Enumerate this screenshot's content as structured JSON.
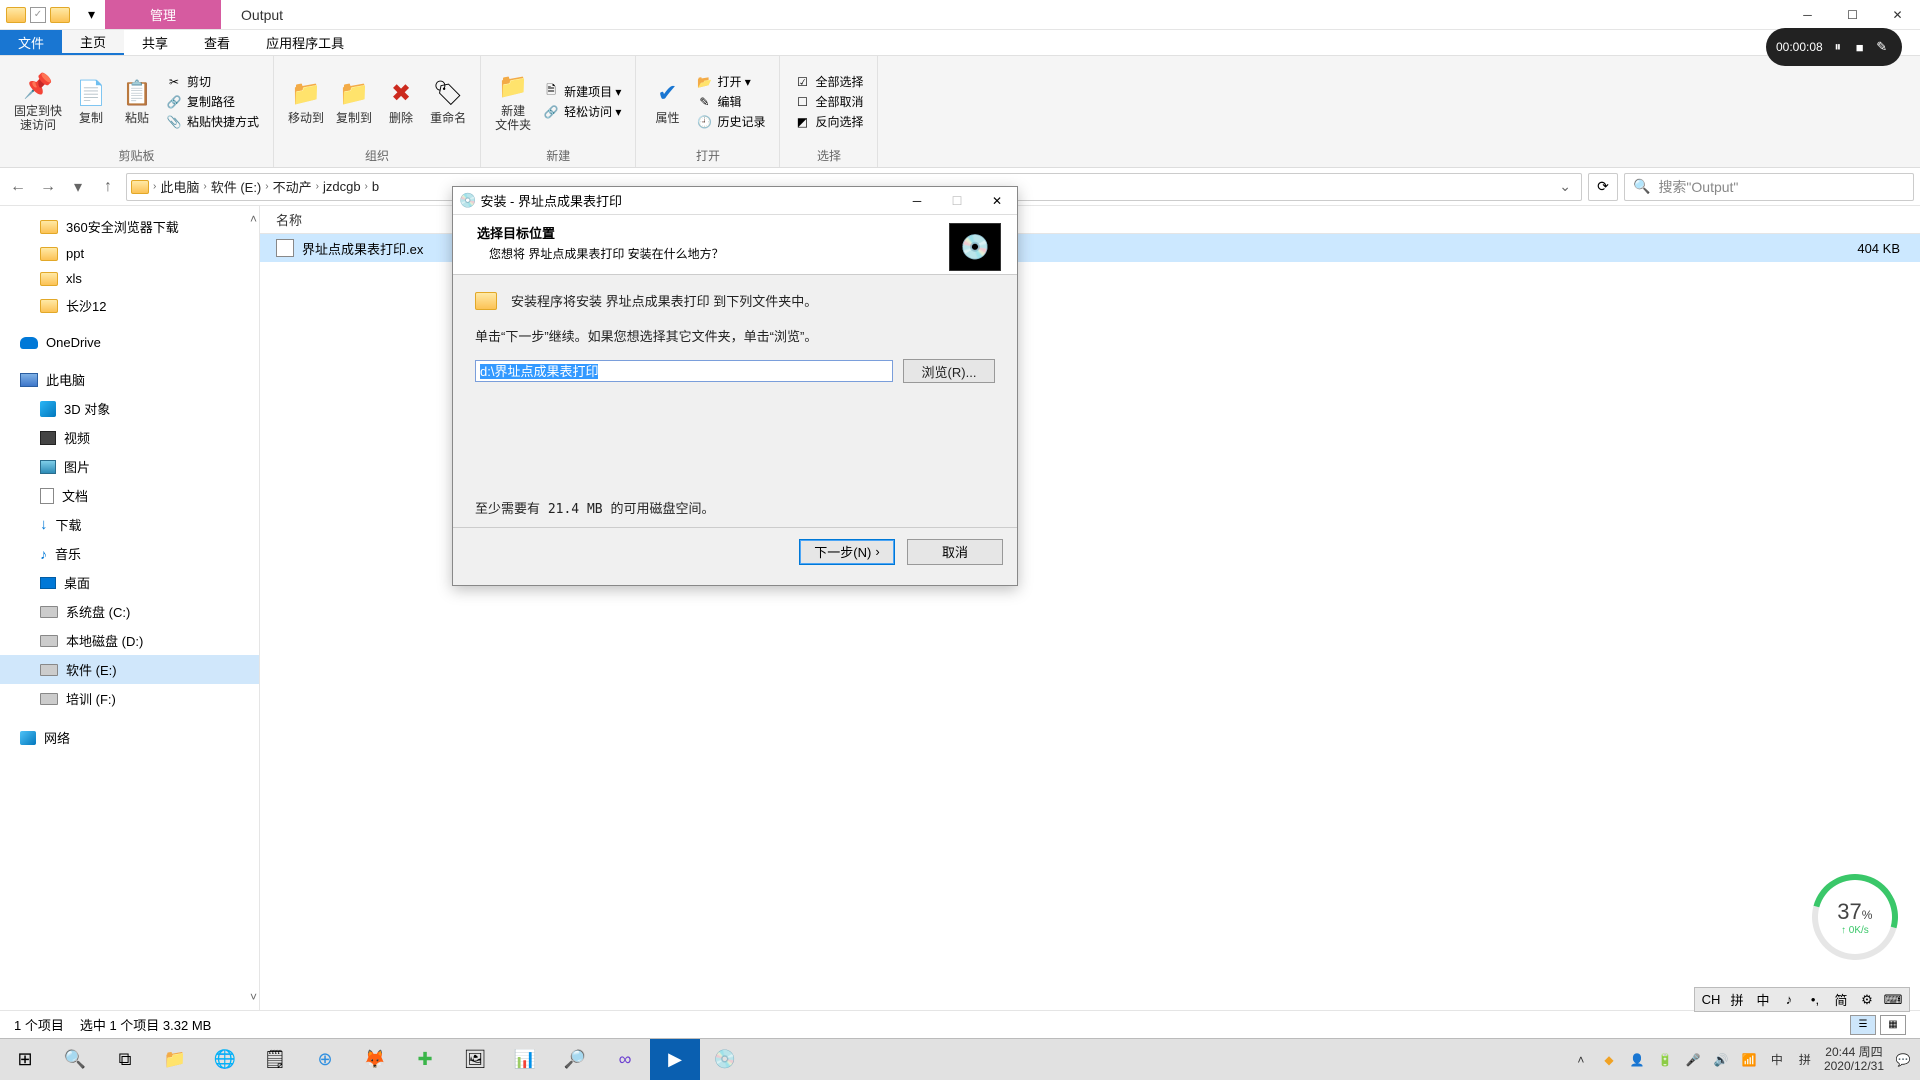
{
  "window": {
    "manage_tab": "管理",
    "title": "Output",
    "min": "─",
    "max": "☐",
    "close": "✕"
  },
  "menu": {
    "file": "文件",
    "home": "主页",
    "share": "共享",
    "view": "查看",
    "apptools": "应用程序工具"
  },
  "ribbon": {
    "pin": "固定到快\n速访问",
    "copy": "复制",
    "paste": "粘贴",
    "cut": "剪切",
    "copypath": "复制路径",
    "pasteshortcut": "粘贴快捷方式",
    "g1": "剪贴板",
    "moveto": "移动到",
    "copyto": "复制到",
    "delete": "删除",
    "rename": "重命名",
    "g2": "组织",
    "newfolder": "新建\n文件夹",
    "newitem": "新建项目 ▾",
    "easyaccess": "轻松访问 ▾",
    "g3": "新建",
    "properties": "属性",
    "open": "打开 ▾",
    "edit": "编辑",
    "history": "历史记录",
    "g4": "打开",
    "selectall": "全部选择",
    "selectnone": "全部取消",
    "invertsel": "反向选择",
    "g5": "选择"
  },
  "addr": {
    "back": "←",
    "fwd": "→",
    "up": "↑",
    "crumbs": [
      "此电脑",
      "软件 (E:)",
      "不动产",
      "jzdcgb",
      "b"
    ],
    "refresh": "⟳",
    "search_ph": "搜索\"Output\""
  },
  "sidebar": [
    {
      "k": "folder",
      "t": "360安全浏览器下载",
      "i": 1
    },
    {
      "k": "folder",
      "t": "ppt",
      "i": 1
    },
    {
      "k": "folder",
      "t": "xls",
      "i": 1
    },
    {
      "k": "folder",
      "t": "长沙12",
      "i": 1
    },
    {
      "k": "od",
      "t": "OneDrive",
      "i": 0,
      "gap": 1
    },
    {
      "k": "pc",
      "t": "此电脑",
      "i": 0,
      "gap": 1
    },
    {
      "k": "3d",
      "t": "3D 对象",
      "i": 1
    },
    {
      "k": "vid",
      "t": "视频",
      "i": 1
    },
    {
      "k": "pic",
      "t": "图片",
      "i": 1
    },
    {
      "k": "doc",
      "t": "文档",
      "i": 1
    },
    {
      "k": "dl",
      "t": "下载",
      "i": 1
    },
    {
      "k": "music",
      "t": "音乐",
      "i": 1
    },
    {
      "k": "desk",
      "t": "桌面",
      "i": 1
    },
    {
      "k": "drive",
      "t": "系统盘 (C:)",
      "i": 1
    },
    {
      "k": "drive",
      "t": "本地磁盘 (D:)",
      "i": 1
    },
    {
      "k": "drive",
      "t": "软件 (E:)",
      "i": 1,
      "sel": 1
    },
    {
      "k": "drive",
      "t": "培训 (F:)",
      "i": 1
    },
    {
      "k": "net",
      "t": "网络",
      "i": 0,
      "gap": 1
    }
  ],
  "columns": {
    "name": "名称"
  },
  "files": [
    {
      "name": "界址点成果表打印.ex",
      "size": "404 KB"
    }
  ],
  "status": {
    "count": "1 个项目",
    "selected": "选中 1 个项目 3.32 MB"
  },
  "dialog": {
    "title": "安装 - 界址点成果表打印",
    "header": "选择目标位置",
    "sub": "您想将 界址点成果表打印 安装在什么地方？",
    "line1": "安装程序将安装 界址点成果表打印 到下列文件夹中。",
    "line2": "单击“下一步”继续。如果您想选择其它文件夹，单击“浏览”。",
    "path": "d:\\界址点成果表打印",
    "browse": "浏览(R)...",
    "space": "至少需要有 21.4 MB 的可用磁盘空间。",
    "next": "下一步(N)",
    "cancel": "取消",
    "min": "─",
    "max": "☐",
    "close": "✕"
  },
  "recorder": {
    "time": "00:00:08"
  },
  "gauge": {
    "pct": "37",
    "unit": "%",
    "rate": "0K/s"
  },
  "ime": {
    "items": [
      "CH",
      "拼",
      "中",
      "♪",
      "•,",
      "简",
      "⚙",
      "⌨"
    ]
  },
  "tray": {
    "ch": "中",
    "pinyin": "拼",
    "time": "20:44 周四",
    "date": "2020/12/31"
  }
}
